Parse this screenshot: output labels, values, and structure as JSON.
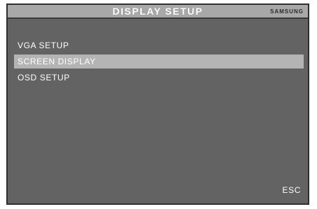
{
  "header": {
    "title": "DISPLAY SETUP",
    "brand": "SAMSUNG"
  },
  "menu": {
    "items": [
      {
        "label": "VGA SETUP",
        "selected": false
      },
      {
        "label": "SCREEN DISPLAY",
        "selected": true
      },
      {
        "label": "OSD SETUP",
        "selected": false
      }
    ]
  },
  "footer": {
    "esc_label": "ESC"
  },
  "colors": {
    "panel_background": "#636363",
    "title_bar": "#a8a8a8",
    "selected_row": "#b4b4b4",
    "text": "#ffffff"
  }
}
